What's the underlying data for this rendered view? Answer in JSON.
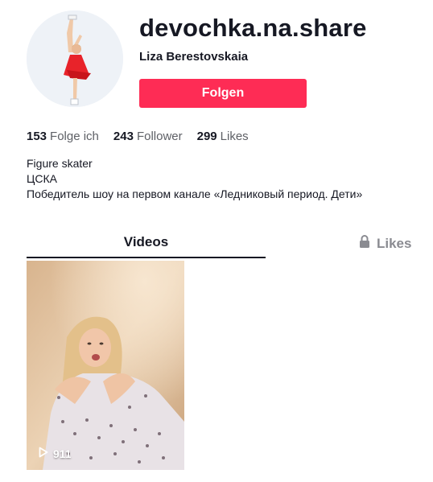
{
  "profile": {
    "username": "devochka.na.share",
    "full_name": "Liza Berestovskaia",
    "follow_label": "Folgen",
    "accent_color": "#fe2c55"
  },
  "stats": {
    "following_count": "153",
    "following_label": "Folge ich",
    "followers_count": "243",
    "followers_label": "Follower",
    "likes_count": "299",
    "likes_label": "Likes"
  },
  "bio": {
    "line1": "Figure skater",
    "line2": "ЦСКА",
    "line3": "Победитель шоу на первом канале «Ледниковый период. Дети»"
  },
  "tabs": {
    "videos_label": "Videos",
    "likes_label": "Likes",
    "likes_icon": "lock-icon",
    "active": "Videos"
  },
  "videos": [
    {
      "play_count": "911",
      "play_icon": "play-icon"
    }
  ]
}
